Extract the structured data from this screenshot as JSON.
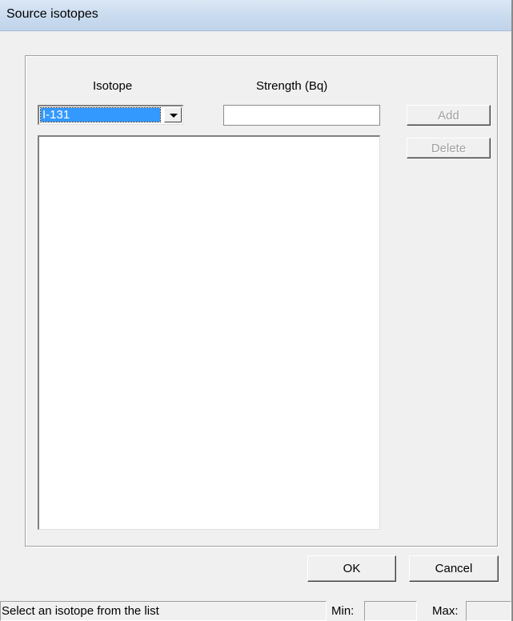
{
  "window": {
    "title": "Source isotopes"
  },
  "form": {
    "isotope_label": "Isotope",
    "strength_label": "Strength (Bq)",
    "isotope_selected": "I-131",
    "strength_value": ""
  },
  "buttons": {
    "add": "Add",
    "delete": "Delete",
    "ok": "OK",
    "cancel": "Cancel"
  },
  "list": {
    "items": []
  },
  "status": {
    "message": "Select an isotope from the list",
    "min_label": "Min:",
    "min_value": "",
    "max_label": "Max:",
    "max_value": ""
  }
}
